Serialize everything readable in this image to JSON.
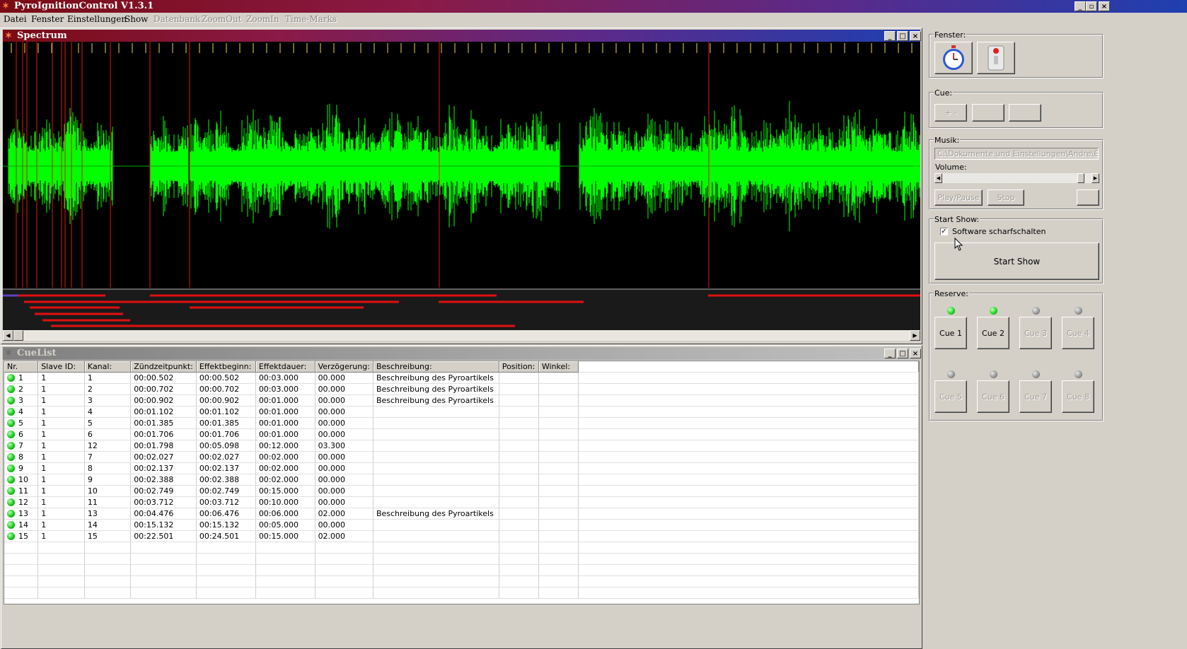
{
  "app": {
    "title": "PyroIgnitionControl V1.3.1"
  },
  "menu": {
    "items": [
      {
        "label": "Datei",
        "enabled": true
      },
      {
        "label": "Fenster",
        "enabled": true
      },
      {
        "label": "Einstellungen",
        "enabled": true
      },
      {
        "label": "Show",
        "enabled": true
      },
      {
        "label": "Datenbank",
        "enabled": false
      },
      {
        "label": "ZoomOut",
        "enabled": false
      },
      {
        "label": "ZoomIn",
        "enabled": false
      },
      {
        "label": "Time-Marks",
        "enabled": false
      }
    ]
  },
  "spectrum": {
    "title": "Spectrum",
    "waveform_color": "#00ff00",
    "marker_color": "#ff2020"
  },
  "cuelist": {
    "title": "CueList",
    "columns": [
      "Nr.",
      "Slave ID:",
      "Kanal:",
      "Zündzeitpunkt:",
      "Effektbeginn:",
      "Effektdauer:",
      "Verzögerung:",
      "Beschreibung:",
      "Position:",
      "Winkel:"
    ],
    "rows": [
      [
        "1",
        "1",
        "1",
        "00:00.502",
        "00:00.502",
        "00:03.000",
        "00.000",
        "Beschreibung des Pyroartikels",
        "",
        ""
      ],
      [
        "2",
        "1",
        "2",
        "00:00.702",
        "00:00.702",
        "00:03.000",
        "00.000",
        "Beschreibung des Pyroartikels",
        "",
        ""
      ],
      [
        "3",
        "1",
        "3",
        "00:00.902",
        "00:00.902",
        "00:01.000",
        "00.000",
        "Beschreibung des Pyroartikels",
        "",
        ""
      ],
      [
        "4",
        "1",
        "4",
        "00:01.102",
        "00:01.102",
        "00:01.000",
        "00.000",
        "",
        "",
        ""
      ],
      [
        "5",
        "1",
        "5",
        "00:01.385",
        "00:01.385",
        "00:01.000",
        "00.000",
        "",
        "",
        ""
      ],
      [
        "6",
        "1",
        "6",
        "00:01.706",
        "00:01.706",
        "00:01.000",
        "00.000",
        "",
        "",
        ""
      ],
      [
        "7",
        "1",
        "12",
        "00:01.798",
        "00:05.098",
        "00:12.000",
        "03.300",
        "",
        "",
        ""
      ],
      [
        "8",
        "1",
        "7",
        "00:02.027",
        "00:02.027",
        "00:02.000",
        "00.000",
        "",
        "",
        ""
      ],
      [
        "9",
        "1",
        "8",
        "00:02.137",
        "00:02.137",
        "00:02.000",
        "00.000",
        "",
        "",
        ""
      ],
      [
        "10",
        "1",
        "9",
        "00:02.388",
        "00:02.388",
        "00:02.000",
        "00.000",
        "",
        "",
        ""
      ],
      [
        "11",
        "1",
        "10",
        "00:02.749",
        "00:02.749",
        "00:15.000",
        "00.000",
        "",
        "",
        ""
      ],
      [
        "12",
        "1",
        "11",
        "00:03.712",
        "00:03.712",
        "00:10.000",
        "00.000",
        "",
        "",
        ""
      ],
      [
        "13",
        "1",
        "13",
        "00:04.476",
        "00:06.476",
        "00:06.000",
        "02.000",
        "Beschreibung des Pyroartikels",
        "",
        ""
      ],
      [
        "14",
        "1",
        "14",
        "00:15.132",
        "00:15.132",
        "00:05.000",
        "00.000",
        "",
        "",
        ""
      ],
      [
        "15",
        "1",
        "15",
        "00:22.501",
        "00:24.501",
        "00:15.000",
        "02.000",
        "",
        "",
        ""
      ]
    ]
  },
  "panel": {
    "fenster": {
      "label": "Fenster:"
    },
    "cue": {
      "label": "Cue:",
      "btn1": "+ -"
    },
    "musik": {
      "label": "Musik:",
      "path": "C:\\Dokumente und Einstellungen\\Andre\\Eigene D",
      "volume_label": "Volume:",
      "volume_level": 0.95,
      "play_label": "Play/Pause",
      "stop_label": "Stop"
    },
    "startshow": {
      "label": "Start Show:",
      "checkbox_label": "Software scharfschalten",
      "checked": true,
      "button_label": "Start Show"
    },
    "reserve": {
      "label": "Reserve:",
      "cues": [
        {
          "label": "Cue 1",
          "led": "on",
          "enabled": true
        },
        {
          "label": "Cue 2",
          "led": "on",
          "enabled": true
        },
        {
          "label": "Cue 3",
          "led": "off",
          "enabled": false
        },
        {
          "label": "Cue 4",
          "led": "off",
          "enabled": false
        },
        {
          "label": "Cue 5",
          "led": "off",
          "enabled": false
        },
        {
          "label": "Cue 6",
          "led": "off",
          "enabled": false
        },
        {
          "label": "Cue 7",
          "led": "off",
          "enabled": false
        },
        {
          "label": "Cue 8",
          "led": "off",
          "enabled": false
        }
      ]
    }
  }
}
